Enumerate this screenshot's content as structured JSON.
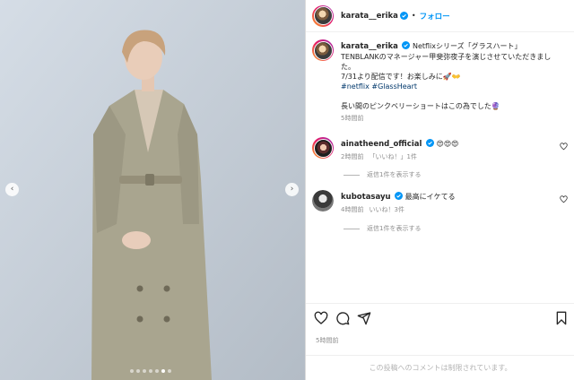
{
  "post": {
    "username": "karata__erika",
    "follow_label": "フォロー",
    "follow_dot": "•",
    "caption_lines": [
      "Netflixシリーズ「グラスハート」",
      "TENBLANKのマネージャー甲斐弥夜子を演じさせていただきまし",
      "た。",
      "7/31より配信です！お楽しみに🚀👐",
      "",
      "長い間のピンクベリーショートはこの為でした🔮"
    ],
    "hashtags": "#netflix #GlassHeart",
    "caption_time": "5時間前",
    "carousel": {
      "slide_count": 7,
      "active_index": 5
    }
  },
  "comments": [
    {
      "username": "ainatheend_official",
      "text": "😍😍😍",
      "time": "2時間前",
      "likes": "「いいね！」1件",
      "replies": "返信1件を表示する"
    },
    {
      "username": "kubotasayu",
      "text": "最高にイケてる",
      "time": "4時間前",
      "likes": "いいね！3件",
      "replies": "返信1件を表示する"
    }
  ],
  "actions": {
    "icons": [
      "heart-icon",
      "comment-icon",
      "share-icon",
      "save-icon"
    ],
    "time": "5時間前"
  },
  "footer": {
    "comments_limited": "この投稿へのコメントは制限されています。"
  },
  "nav": {
    "prev": "‹",
    "next": "›"
  }
}
